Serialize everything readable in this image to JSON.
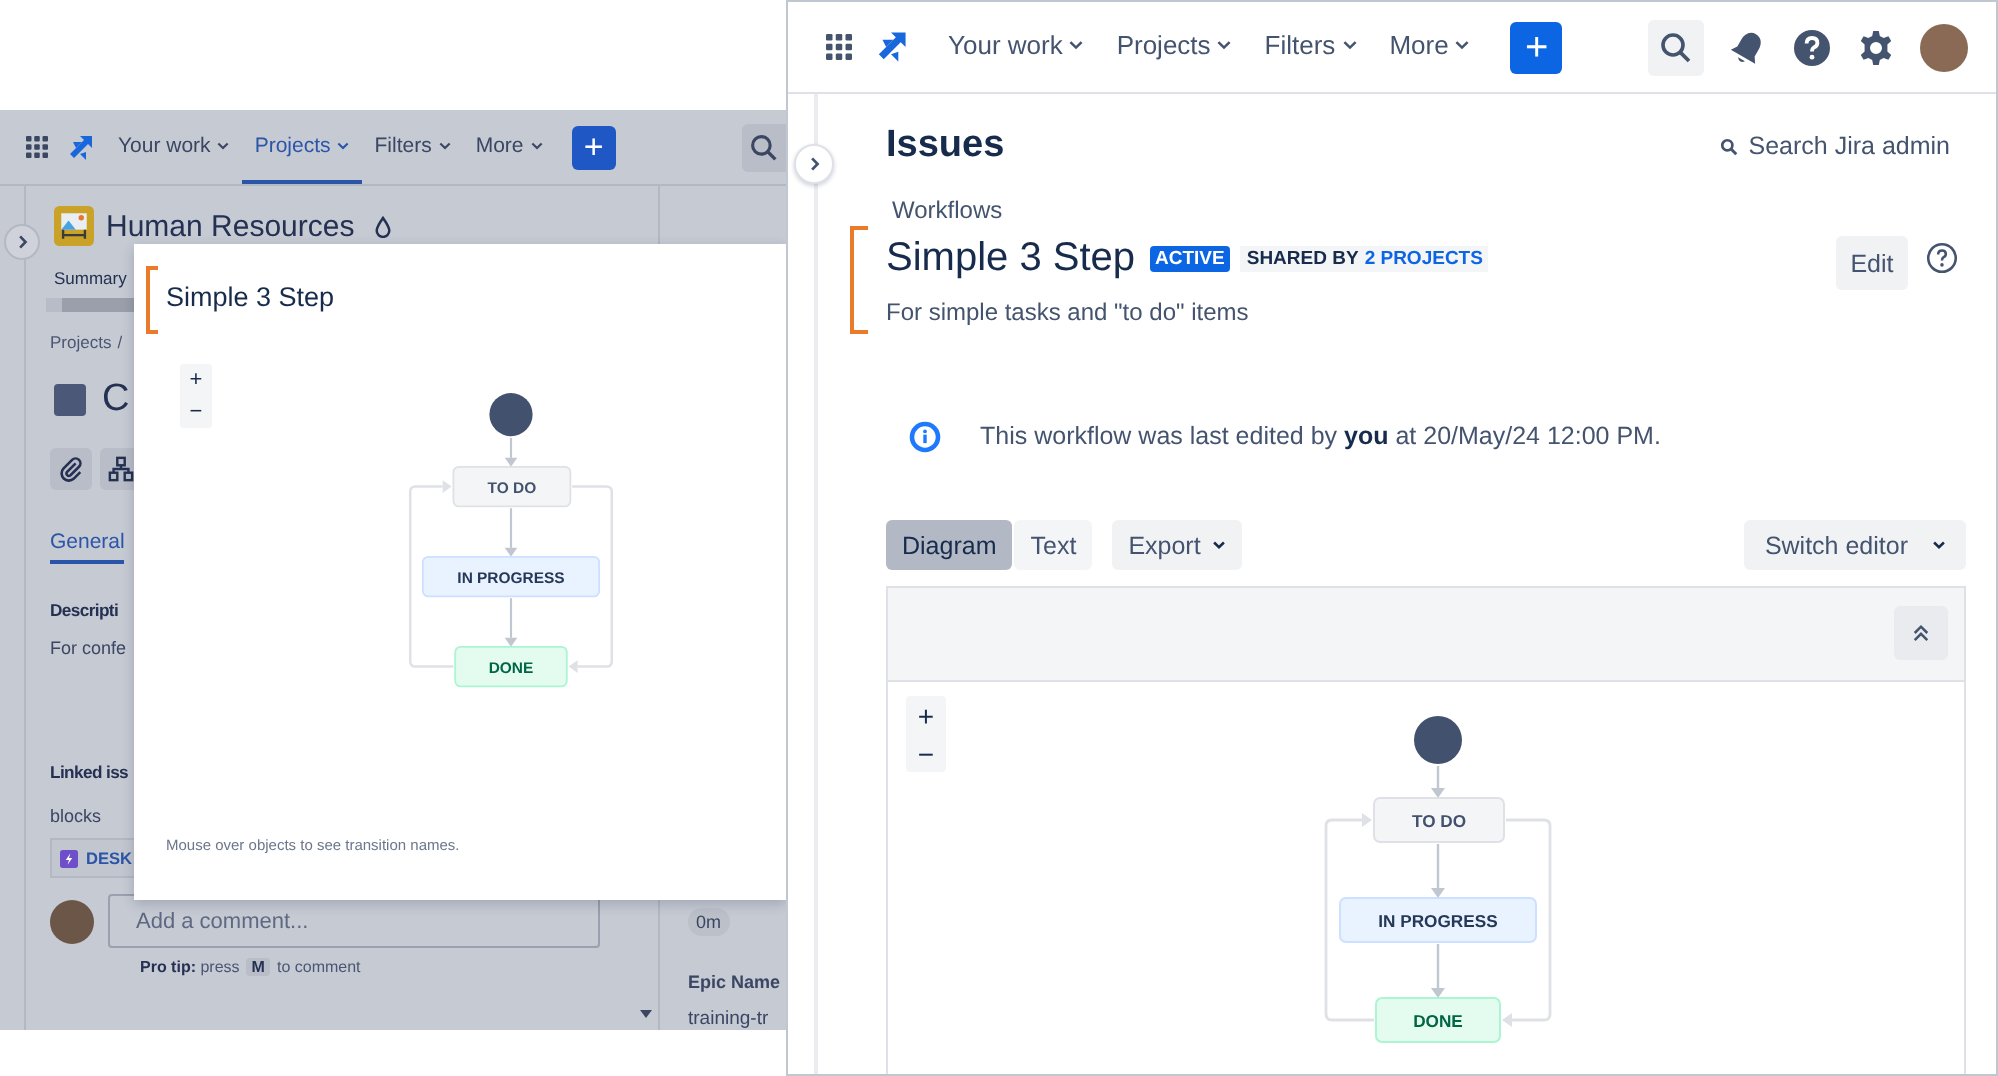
{
  "back_window": {
    "nav": {
      "items": [
        {
          "label": "Your work",
          "selected": false
        },
        {
          "label": "Projects",
          "selected": true
        },
        {
          "label": "Filters",
          "selected": false
        },
        {
          "label": "More",
          "selected": false
        }
      ],
      "create": "+"
    },
    "project_name": "Human Resources",
    "summary_tab": "Summary",
    "breadcrumb": "Projects",
    "breadcrumb_separator": "/",
    "issue_title": "C",
    "detail_tab": "General",
    "description_heading": "Descripti",
    "description_text": "For confe",
    "linked_heading": "Linked iss",
    "link_type": "blocks",
    "linked_issue_key": "DESK",
    "comment": {
      "placeholder": "Add a comment...",
      "tip": "**Pro tip:** press",
      "tip_key": "M",
      "tip_end": "to comment"
    },
    "side_fields": {
      "time_value": "0m",
      "epic_label": "Epic Name",
      "epic_value": "training-tr"
    }
  },
  "modal": {
    "title": "Simple 3 Step",
    "zoom_in": "+",
    "zoom_out": "−",
    "statuses": [
      {
        "name": "TO DO",
        "kind": "todo"
      },
      {
        "name": "IN PROGRESS",
        "kind": "progress"
      },
      {
        "name": "DONE",
        "kind": "done"
      }
    ],
    "hint": "Mouse over objects to see transition names."
  },
  "front_window": {
    "nav": {
      "items": [
        {
          "label": "Your work",
          "selected": false
        },
        {
          "label": "Projects",
          "selected": false
        },
        {
          "label": "Filters",
          "selected": false
        },
        {
          "label": "More",
          "selected": false
        }
      ],
      "create": "+"
    },
    "page_title": "Issues",
    "admin_search": "Search Jira admin",
    "breadcrumb": "Workflows",
    "workflow_name": "Simple 3 Step",
    "status_badge": "ACTIVE",
    "shared_label": "SHARED BY",
    "shared_link": "2 PROJECTS",
    "edit_button": "Edit",
    "description": "For simple tasks and \"to do\" items",
    "notice": "This workflow was last edited by **you** at 20/May/24 12:00 PM.",
    "view_tabs": [
      {
        "label": "Diagram",
        "selected": true
      },
      {
        "label": "Text",
        "selected": false
      }
    ],
    "export_button": "Export",
    "switch_editor": "Switch editor",
    "zoom_in": "+",
    "zoom_out": "−",
    "statuses": [
      {
        "name": "TO DO",
        "kind": "todo"
      },
      {
        "name": "IN PROGRESS",
        "kind": "progress"
      },
      {
        "name": "DONE",
        "kind": "done"
      }
    ]
  }
}
